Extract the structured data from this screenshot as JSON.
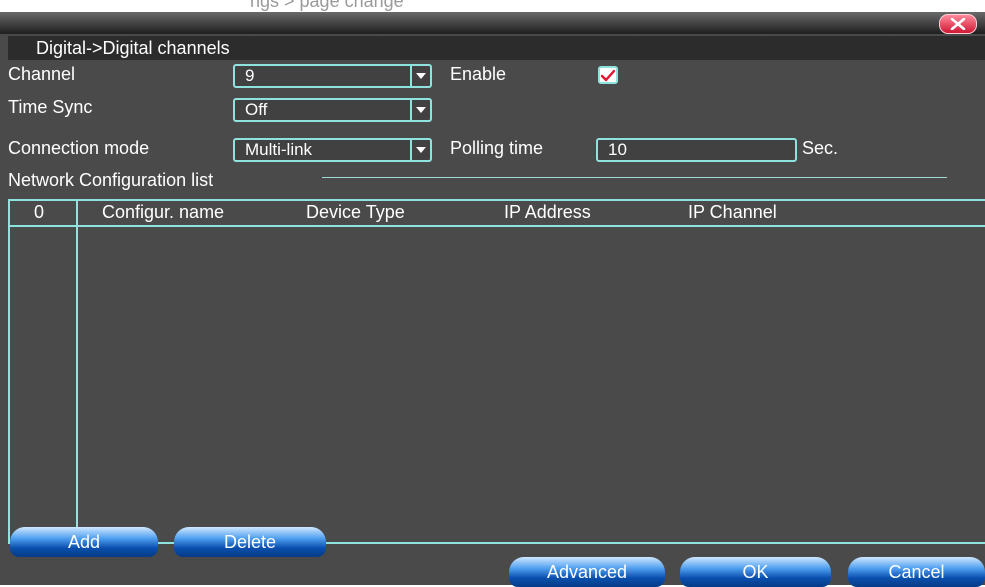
{
  "window": {
    "ghost_text": "ngs > page change",
    "title": "Digital->Digital channels"
  },
  "form": {
    "channel_label": "Channel",
    "channel_value": "9",
    "enable_label": "Enable",
    "enable_checked": true,
    "time_sync_label": "Time Sync",
    "time_sync_value": "Off",
    "connection_mode_label": "Connection mode",
    "connection_mode_value": "Multi-link",
    "polling_time_label": "Polling time",
    "polling_time_value": "10",
    "polling_unit": "Sec."
  },
  "list": {
    "section_title": "Network Configuration list",
    "columns": [
      "0",
      "Configur. name",
      "Device Type",
      "IP Address",
      "IP Channel"
    ],
    "rows": []
  },
  "buttons": {
    "add": "Add",
    "delete": "Delete",
    "advanced": "Advanced",
    "ok": "OK",
    "cancel": "Cancel"
  },
  "colors": {
    "accent": "#8fe3df",
    "panel": "#4a4a4a",
    "button": "#0a4fae",
    "close": "#d01835"
  },
  "icons": [
    "close-icon",
    "dropdown-arrow-icon",
    "checkmark-icon"
  ]
}
